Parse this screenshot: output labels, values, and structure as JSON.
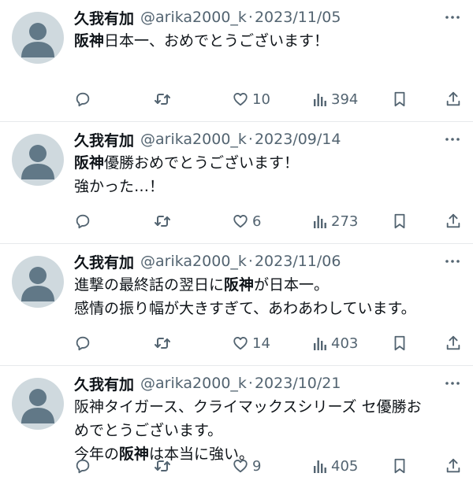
{
  "tweets": [
    {
      "name": "久我有加",
      "handle": "@arika2000_k",
      "sep": "·",
      "date": "2023/11/05",
      "lines": [
        [
          {
            "t": "阪神",
            "b": true
          },
          {
            "t": "日本一、おめでとうございます！",
            "b": false
          }
        ]
      ],
      "replies": "",
      "likes": "10",
      "views": "394"
    },
    {
      "name": "久我有加",
      "handle": "@arika2000_k",
      "sep": "·",
      "date": "2023/09/14",
      "lines": [
        [
          {
            "t": "阪神",
            "b": true
          },
          {
            "t": "優勝おめでとうございます！",
            "b": false
          }
        ],
        [
          {
            "t": "強かった…！",
            "b": false
          }
        ]
      ],
      "replies": "",
      "likes": "6",
      "views": "273"
    },
    {
      "name": "久我有加",
      "handle": "@arika2000_k",
      "sep": "·",
      "date": "2023/11/06",
      "lines": [
        [
          {
            "t": "進撃の最終話の翌日に",
            "b": false
          },
          {
            "t": "阪神",
            "b": true
          },
          {
            "t": "が日本一。",
            "b": false
          }
        ],
        [
          {
            "t": "感情の振り幅が大きすぎて、あわあわしています。",
            "b": false
          }
        ]
      ],
      "replies": "",
      "likes": "14",
      "views": "403"
    },
    {
      "name": "久我有加",
      "handle": "@arika2000_k",
      "sep": "·",
      "date": "2023/10/21",
      "lines": [
        [
          {
            "t": "阪神タイガース、クライマックスシリーズ セ優勝お",
            "b": false
          }
        ],
        [
          {
            "t": "めでとうございます。",
            "b": false
          }
        ],
        [
          {
            "t": "今年の",
            "b": false
          },
          {
            "t": "阪神",
            "b": true
          },
          {
            "t": "は本当に強い。",
            "b": false
          }
        ]
      ],
      "replies": "",
      "likes": "9",
      "views": "405"
    }
  ],
  "icons": {
    "reply": "reply-icon",
    "retweet": "retweet-icon",
    "like": "heart-icon",
    "views": "views-icon",
    "bookmark": "bookmark-icon",
    "share": "share-icon",
    "more": "more-icon"
  },
  "colors": {
    "muted": "#536471",
    "text": "#0f1419",
    "avatar_bg": "#cfd9de",
    "avatar_fg": "#617887"
  }
}
